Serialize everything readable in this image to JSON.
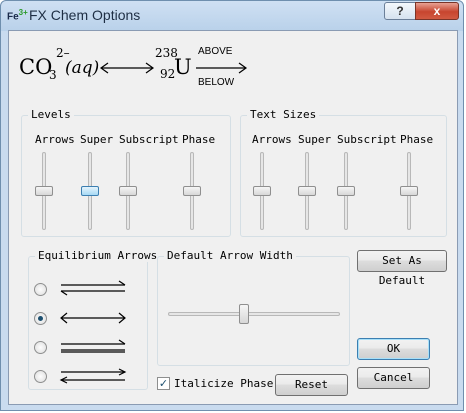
{
  "window": {
    "title": "FX Chem Options",
    "icon_text": "Fe",
    "icon_sup": "3+",
    "help_label": "?",
    "close_label": "x"
  },
  "preview": {
    "formula_base": "CO",
    "formula_sub": "3",
    "formula_sup": "2–",
    "phase": "(aq)",
    "mass_number": "238",
    "atomic_number": "92",
    "element": "U",
    "above": "ABOVE",
    "below": "BELOW"
  },
  "levels": {
    "title": "Levels",
    "columns": [
      "Arrows",
      "Super",
      "Subscript",
      "Phase"
    ],
    "values": [
      0.5,
      0.5,
      0.5,
      0.5
    ]
  },
  "text_sizes": {
    "title": "Text Sizes",
    "columns": [
      "Arrows",
      "Super",
      "Subscript",
      "Phase"
    ],
    "values": [
      0.5,
      0.5,
      0.5,
      0.5
    ]
  },
  "equilibrium": {
    "title": "Equilibrium Arrows",
    "options": [
      "single-harpoon-pair",
      "double-arrow",
      "full-double-harpoon",
      "opposing-arrows"
    ],
    "selected_index": 1
  },
  "arrow_width": {
    "title": "Default Arrow Width",
    "value": 0.45
  },
  "italicize": {
    "label": "Italicize Phase",
    "checked": true
  },
  "buttons": {
    "set_default": "Set As Default",
    "ok": "OK",
    "cancel": "Cancel",
    "reset": "Reset"
  }
}
